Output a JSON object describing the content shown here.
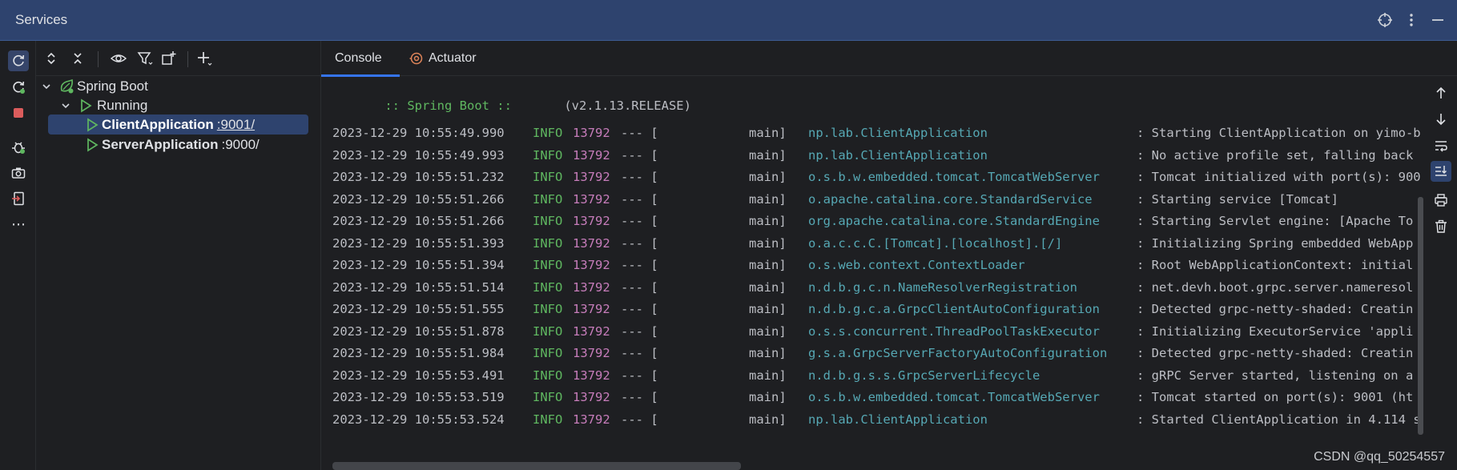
{
  "titlebar": {
    "title": "Services",
    "icons": [
      "target-icon",
      "more-vertical-icon",
      "minimize-icon"
    ]
  },
  "left_toolbar": {
    "icons": [
      "refresh-icon",
      "restart-icon",
      "stop-icon",
      "debug-icon",
      "camera-icon",
      "login-icon",
      "more-icon"
    ],
    "more_label": "⋯"
  },
  "tree_toolbar": {
    "icons": [
      "expand-all-icon",
      "collapse-all-icon",
      "eye-icon",
      "filter-icon",
      "new-group-icon",
      "add-icon"
    ]
  },
  "tree": {
    "root_label": "Spring Boot",
    "group_label": "Running",
    "apps": [
      {
        "name": "ClientApplication",
        "port": ":9001/"
      },
      {
        "name": "ServerApplication",
        "port": ":9000/"
      }
    ]
  },
  "tabs": {
    "console_label": "Console",
    "actuator_label": "Actuator"
  },
  "console": {
    "banner_text": " :: Spring Boot :: ",
    "banner_version": "(v2.1.13.RELEASE)",
    "lines": [
      {
        "ts": "2023-12-29 10:55:49.990",
        "level": "INFO",
        "pid": "13792",
        "sep": "--- [",
        "thread": "main]",
        "logger": "np.lab.ClientApplication",
        "msg": ": Starting ClientApplication on yimo-b"
      },
      {
        "ts": "2023-12-29 10:55:49.993",
        "level": "INFO",
        "pid": "13792",
        "sep": "--- [",
        "thread": "main]",
        "logger": "np.lab.ClientApplication",
        "msg": ": No active profile set, falling back"
      },
      {
        "ts": "2023-12-29 10:55:51.232",
        "level": "INFO",
        "pid": "13792",
        "sep": "--- [",
        "thread": "main]",
        "logger": "o.s.b.w.embedded.tomcat.TomcatWebServer",
        "msg": ": Tomcat initialized with port(s): 900"
      },
      {
        "ts": "2023-12-29 10:55:51.266",
        "level": "INFO",
        "pid": "13792",
        "sep": "--- [",
        "thread": "main]",
        "logger": "o.apache.catalina.core.StandardService",
        "msg": ": Starting service [Tomcat]"
      },
      {
        "ts": "2023-12-29 10:55:51.266",
        "level": "INFO",
        "pid": "13792",
        "sep": "--- [",
        "thread": "main]",
        "logger": "org.apache.catalina.core.StandardEngine",
        "msg": ": Starting Servlet engine: [Apache To"
      },
      {
        "ts": "2023-12-29 10:55:51.393",
        "level": "INFO",
        "pid": "13792",
        "sep": "--- [",
        "thread": "main]",
        "logger": "o.a.c.c.C.[Tomcat].[localhost].[/]",
        "msg": ": Initializing Spring embedded WebApp"
      },
      {
        "ts": "2023-12-29 10:55:51.394",
        "level": "INFO",
        "pid": "13792",
        "sep": "--- [",
        "thread": "main]",
        "logger": "o.s.web.context.ContextLoader",
        "msg": ": Root WebApplicationContext: initial"
      },
      {
        "ts": "2023-12-29 10:55:51.514",
        "level": "INFO",
        "pid": "13792",
        "sep": "--- [",
        "thread": "main]",
        "logger": "n.d.b.g.c.n.NameResolverRegistration",
        "msg": ": net.devh.boot.grpc.server.nameresol"
      },
      {
        "ts": "2023-12-29 10:55:51.555",
        "level": "INFO",
        "pid": "13792",
        "sep": "--- [",
        "thread": "main]",
        "logger": "n.d.b.g.c.a.GrpcClientAutoConfiguration",
        "msg": ": Detected grpc-netty-shaded: Creatin"
      },
      {
        "ts": "2023-12-29 10:55:51.878",
        "level": "INFO",
        "pid": "13792",
        "sep": "--- [",
        "thread": "main]",
        "logger": "o.s.s.concurrent.ThreadPoolTaskExecutor",
        "msg": ": Initializing ExecutorService 'appli"
      },
      {
        "ts": "2023-12-29 10:55:51.984",
        "level": "INFO",
        "pid": "13792",
        "sep": "--- [",
        "thread": "main]",
        "logger": "g.s.a.GrpcServerFactoryAutoConfiguration",
        "msg": ": Detected grpc-netty-shaded: Creatin"
      },
      {
        "ts": "2023-12-29 10:55:53.491",
        "level": "INFO",
        "pid": "13792",
        "sep": "--- [",
        "thread": "main]",
        "logger": "n.d.b.g.s.s.GrpcServerLifecycle",
        "msg": ": gRPC Server started, listening on a"
      },
      {
        "ts": "2023-12-29 10:55:53.519",
        "level": "INFO",
        "pid": "13792",
        "sep": "--- [",
        "thread": "main]",
        "logger": "o.s.b.w.embedded.tomcat.TomcatWebServer",
        "msg": ": Tomcat started on port(s): 9001 (ht"
      },
      {
        "ts": "2023-12-29 10:55:53.524",
        "level": "INFO",
        "pid": "13792",
        "sep": "--- [",
        "thread": "main]",
        "logger": "np.lab.ClientApplication",
        "msg": ": Started ClientApplication in 4.114 s"
      }
    ]
  },
  "right_toolbar": {
    "icons": [
      "scroll-up-icon",
      "scroll-down-icon",
      "soft-wrap-icon",
      "scroll-to-end-icon",
      "print-icon",
      "clear-icon"
    ]
  },
  "watermark": "CSDN @qq_50254557",
  "colors": {
    "titlebar_bg": "#2e436e",
    "info_level": "#5fb760",
    "pid": "#c77dbb",
    "logger": "#56a8b4",
    "run_icon": "#5fb760",
    "stop_icon": "#db5c5c",
    "selection": "#2e436e"
  }
}
